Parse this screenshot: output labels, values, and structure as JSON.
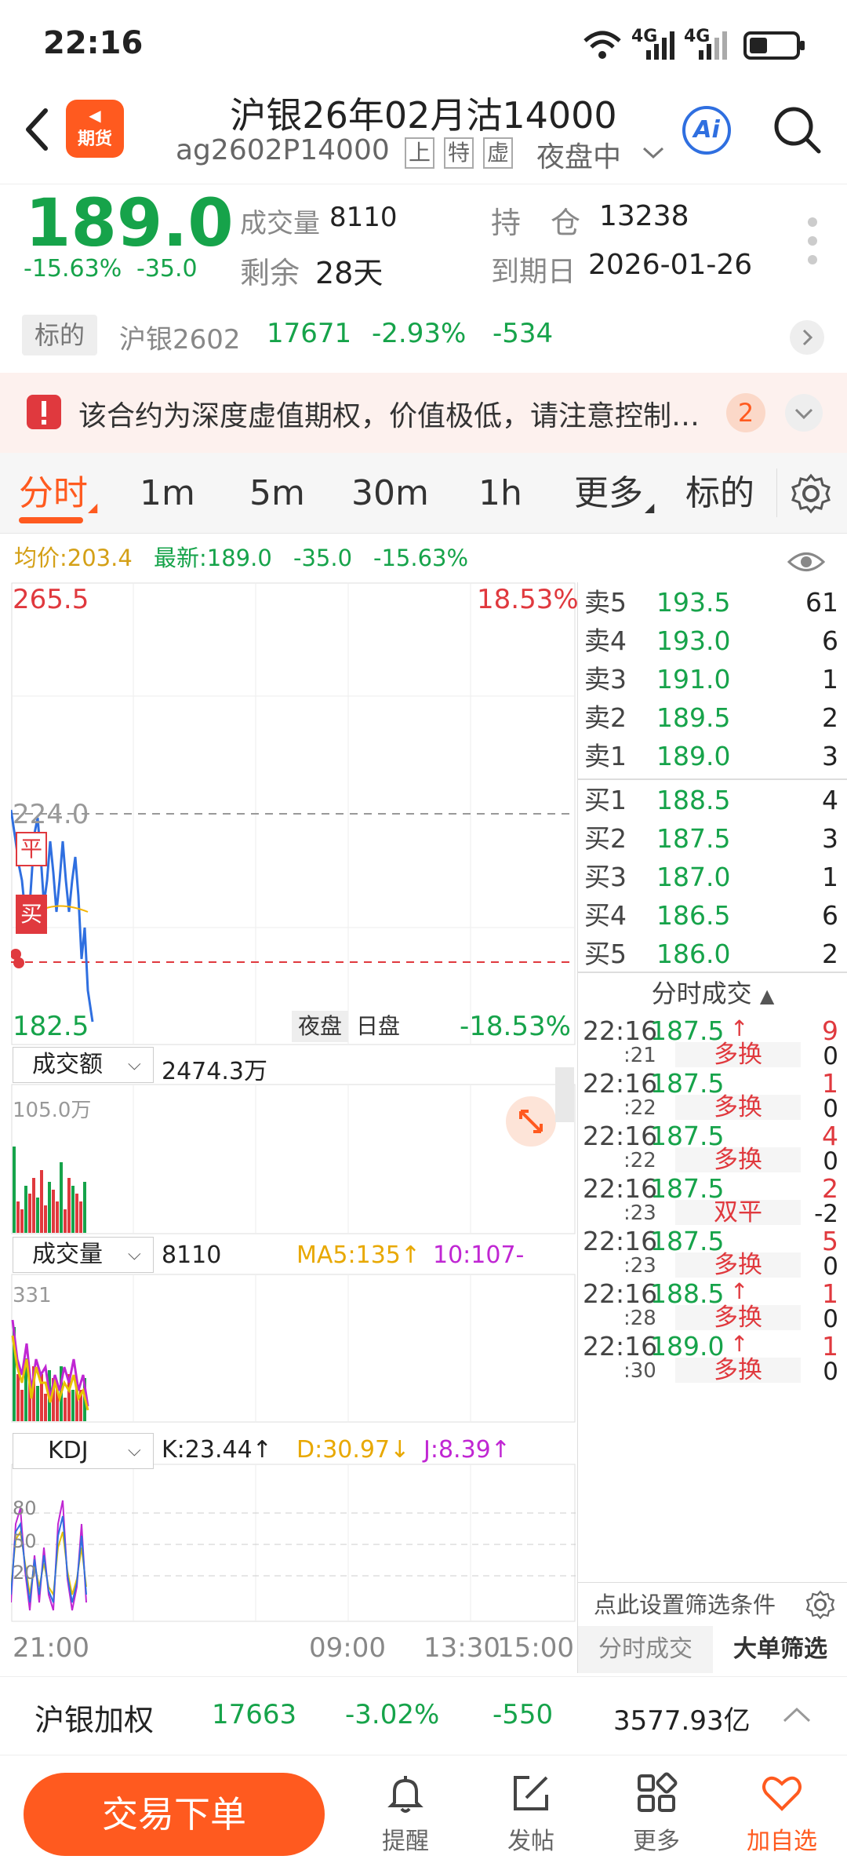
{
  "status_bar": {
    "time": "22:16",
    "net1": "4G",
    "net2": "4G"
  },
  "header": {
    "back_icon": "back-arrow-icon",
    "logo_text": "期货",
    "title": "沪银26年02月沽14000",
    "code": "ag2602P14000",
    "tag1": "上",
    "tag2": "特",
    "tag3": "虚",
    "session": "夜盘中",
    "ai_label": "Ai"
  },
  "quote": {
    "price": "189.0",
    "change_pct": "-15.63%",
    "change": "-35.0",
    "volume_label": "成交量",
    "volume": "8110",
    "oi_label": "持　仓",
    "oi": "13238",
    "remain_label": "剩余",
    "remain": "28天",
    "expiry_label": "到期日",
    "expiry": "2026-01-26"
  },
  "underlying": {
    "tag": "标的",
    "name": "沪银2602",
    "price": "17671",
    "pct": "-2.93%",
    "change": "-534"
  },
  "warning": {
    "text": "该合约为深度虚值期权，价值极低，请注意控制…",
    "count": "2"
  },
  "tabs": [
    "分时",
    "1m",
    "5m",
    "30m",
    "1h",
    "更多",
    "标的"
  ],
  "avgline": {
    "avg": "均价:203.4",
    "latest": "最新:189.0",
    "chg": "-35.0",
    "pct": "-15.63%"
  },
  "main_chart": {
    "high": "265.5",
    "high_pct": "18.53%",
    "mid": "224.0",
    "low": "182.5",
    "low_pct": "-18.53%",
    "marker_ping": "平",
    "marker_mai": "买",
    "session_night": "夜盘",
    "session_day": "日盘"
  },
  "amount_panel": {
    "label": "成交额",
    "value": "2474.3万",
    "max": "105.0万"
  },
  "volume_panel": {
    "label": "成交量",
    "value": "8110",
    "ma5": "MA5:135↑",
    "ma10": "10:107-",
    "max": "331"
  },
  "kdj_panel": {
    "label": "KDJ",
    "k": "K:23.44↑",
    "d": "D:30.97↓",
    "j": "J:8.39↑",
    "levels": [
      "80",
      "50",
      "20"
    ]
  },
  "time_axis": {
    "t1": "21:00",
    "t2": "09:00",
    "t3": "13:30",
    "t4": "15:00"
  },
  "orderbook": {
    "asks": [
      {
        "label": "卖5",
        "price": "193.5",
        "qty": "61"
      },
      {
        "label": "卖4",
        "price": "193.0",
        "qty": "6"
      },
      {
        "label": "卖3",
        "price": "191.0",
        "qty": "1"
      },
      {
        "label": "卖2",
        "price": "189.5",
        "qty": "2"
      },
      {
        "label": "卖1",
        "price": "189.0",
        "qty": "3"
      }
    ],
    "bids": [
      {
        "label": "买1",
        "price": "188.5",
        "qty": "4"
      },
      {
        "label": "买2",
        "price": "187.5",
        "qty": "3"
      },
      {
        "label": "买3",
        "price": "187.0",
        "qty": "1"
      },
      {
        "label": "买4",
        "price": "186.5",
        "qty": "6"
      },
      {
        "label": "买5",
        "price": "186.0",
        "qty": "2"
      }
    ]
  },
  "trades_header": "分时成交",
  "trades": [
    {
      "time": "22:16",
      "sec": ":21",
      "price": "187.5",
      "arrow": "↑",
      "qty": "9",
      "type": "多换",
      "oi": "0"
    },
    {
      "time": "22:16",
      "sec": ":22",
      "price": "187.5",
      "arrow": "",
      "qty": "1",
      "type": "多换",
      "oi": "0"
    },
    {
      "time": "22:16",
      "sec": ":22",
      "price": "187.5",
      "arrow": "",
      "qty": "4",
      "type": "多换",
      "oi": "0"
    },
    {
      "time": "22:16",
      "sec": ":23",
      "price": "187.5",
      "arrow": "",
      "qty": "2",
      "type": "双平",
      "oi": "-2"
    },
    {
      "time": "22:16",
      "sec": ":23",
      "price": "187.5",
      "arrow": "",
      "qty": "5",
      "type": "多换",
      "oi": "0"
    },
    {
      "time": "22:16",
      "sec": ":28",
      "price": "188.5",
      "arrow": "↑",
      "qty": "1",
      "type": "多换",
      "oi": "0"
    },
    {
      "time": "22:16",
      "sec": ":30",
      "price": "189.0",
      "arrow": "↑",
      "qty": "1",
      "type": "多换",
      "oi": "0"
    }
  ],
  "filter_text": "点此设置筛选条件",
  "subtabs": {
    "left": "分时成交",
    "right": "大单筛选"
  },
  "bottom_quote": {
    "name": "沪银加权",
    "price": "17663",
    "pct": "-3.02%",
    "chg": "-550",
    "amount": "3577.93亿"
  },
  "bottom_nav": {
    "trade": "交易下单",
    "remind": "提醒",
    "post": "发帖",
    "more": "更多",
    "fav": "加自选"
  }
}
